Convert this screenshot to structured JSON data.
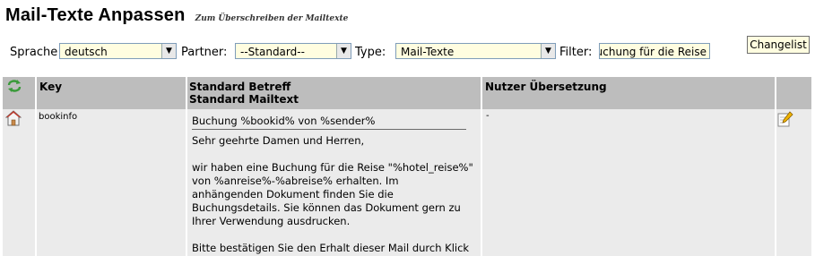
{
  "header": {
    "title": "Mail-Texte Anpassen",
    "subtitle": "Zum Überschreiben der Mailtexte"
  },
  "filters": {
    "sprache_label": "Sprache",
    "sprache_value": "deutsch",
    "partner_label": "Partner:",
    "partner_value": "--Standard--",
    "type_label": "Type:",
    "type_value": "Mail-Texte",
    "filter_label": "Filter:",
    "filter_value": "Buchung für die Reise"
  },
  "changelist_button": "Changelist",
  "table": {
    "columns": {
      "key": "Key",
      "standard_betreff": "Standard Betreff",
      "standard_mailtext": "Standard Mailtext",
      "nutzer_uebersetzung": "Nutzer Übersetzung"
    },
    "rows": [
      {
        "key": "bookinfo",
        "subject": "Buchung %bookid% von %sender%",
        "body": "Sehr geehrte Damen und Herren,\n\nwir haben eine Buchung für die Reise \"%hotel_reise%\"\nvon %anreise%-%abreise% erhalten. Im\nanhängenden Dokument finden Sie die\nBuchungsdetails. Sie können das Dokument gern zu\nIhrer Verwendung ausdrucken.\n\nBitte bestätigen Sie den Erhalt dieser Mail durch Klick",
        "translation": "-"
      }
    ]
  },
  "icons": {
    "refresh": "refresh-icon",
    "home": "home-icon",
    "edit": "edit-pencil-icon"
  },
  "colors": {
    "header_bg": "#bdbdbd",
    "row_bg": "#ebebeb",
    "input_bg": "#fffde0",
    "input_border": "#7f9db9"
  }
}
